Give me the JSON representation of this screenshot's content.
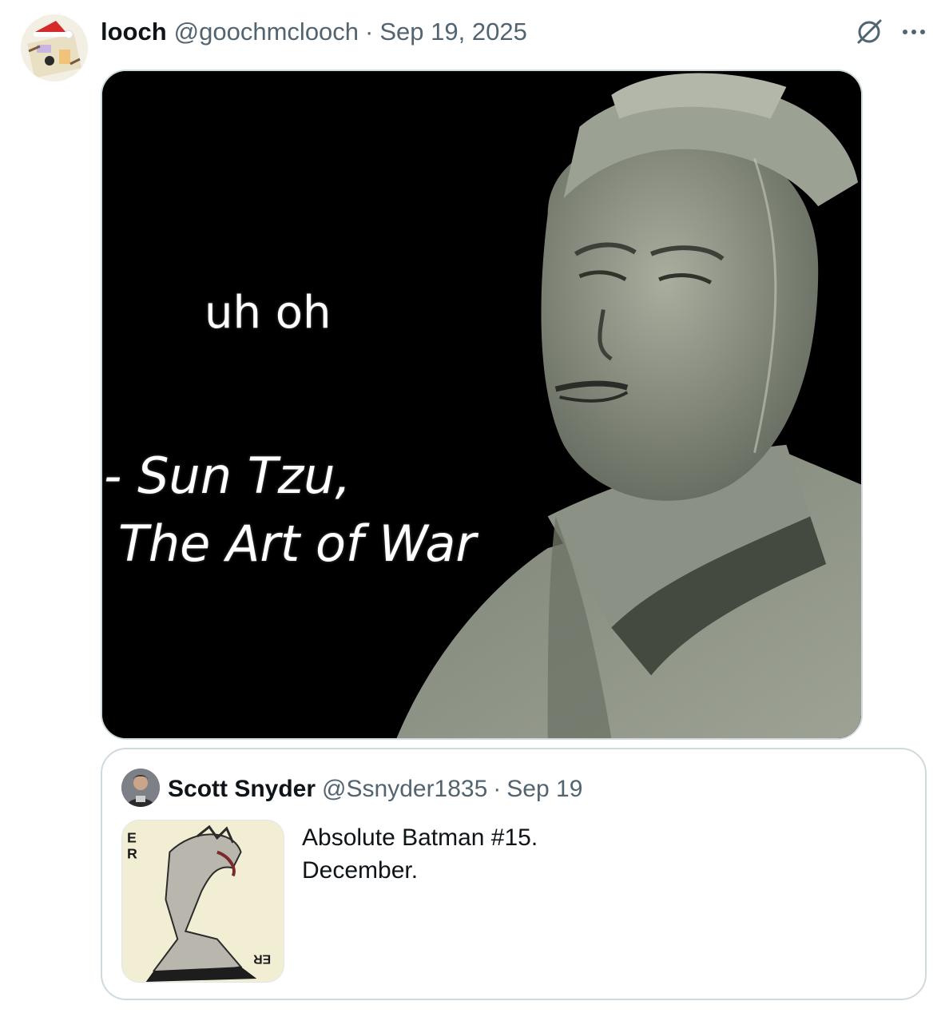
{
  "tweet": {
    "display_name": "looch",
    "handle": "@goochmclooch",
    "separator": "·",
    "date": "Sep 19, 2025",
    "avatar_icon": "avatar-cartoon-santa-hat",
    "actions": {
      "grok_icon": "grok-icon",
      "more_icon": "more-options-icon"
    }
  },
  "media": {
    "caption_top": "uh oh",
    "caption_line1": "- Sun Tzu,",
    "caption_line2": "The Art of War",
    "colors": {
      "background": "#000000",
      "statue": "#8f968c"
    }
  },
  "quote": {
    "display_name": "Scott Snyder",
    "handle": "@Ssnyder1835",
    "separator": "·",
    "date": "Sep 19",
    "text_lines": [
      "Absolute Batman #15.",
      "December."
    ],
    "thumbnail_icon": "comic-cover-thumbnail"
  },
  "colors": {
    "text_primary": "#0f1419",
    "text_secondary": "#536471",
    "border": "#cfd9de"
  }
}
